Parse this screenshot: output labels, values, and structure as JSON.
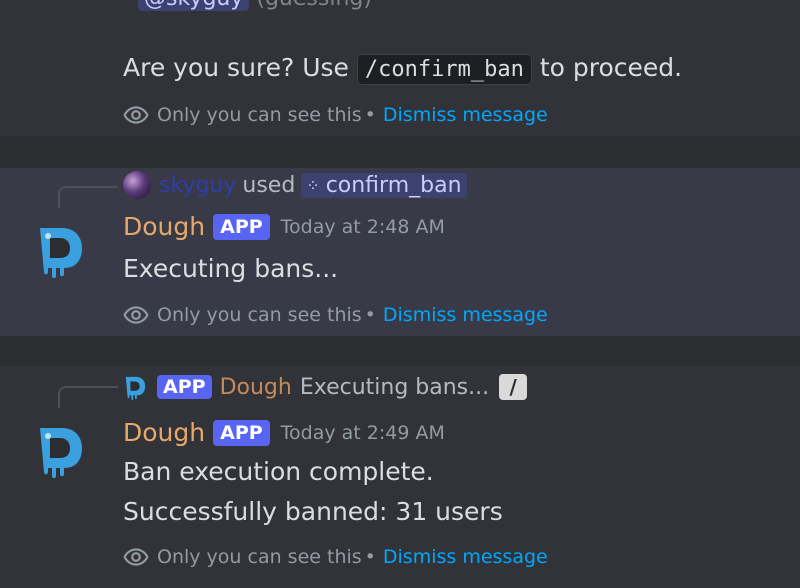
{
  "top": {
    "cutoff_pill": "@skyguy",
    "cutoff_text": "(guessing)",
    "question_before": "Are you sure? Use",
    "command_code": "/confirm_ban",
    "question_after": "to proceed.",
    "ephemeral_note": "Only you can see this",
    "dismiss": "Dismiss message"
  },
  "message1": {
    "reply_user": "skyguy",
    "reply_used": "used",
    "reply_command": "confirm_ban",
    "author": "Dough",
    "badge": "APP",
    "timestamp": "Today at 2:48 AM",
    "body": "Executing bans...",
    "ephemeral_note": "Only you can see this",
    "dismiss": "Dismiss message"
  },
  "message2": {
    "reply_badge": "APP",
    "reply_author": "Dough",
    "reply_text": "Executing bans...",
    "author": "Dough",
    "badge": "APP",
    "timestamp": "Today at 2:49 AM",
    "body_line1": "Ban execution complete.",
    "body_line2": "Successfully banned: 31 users",
    "ephemeral_note": "Only you can see this",
    "dismiss": "Dismiss message"
  },
  "colors": {
    "background": "#313338",
    "highlight": "#383a47",
    "author": "#e8a86a",
    "app_badge": "#5865f2",
    "link": "#00a8fc"
  }
}
